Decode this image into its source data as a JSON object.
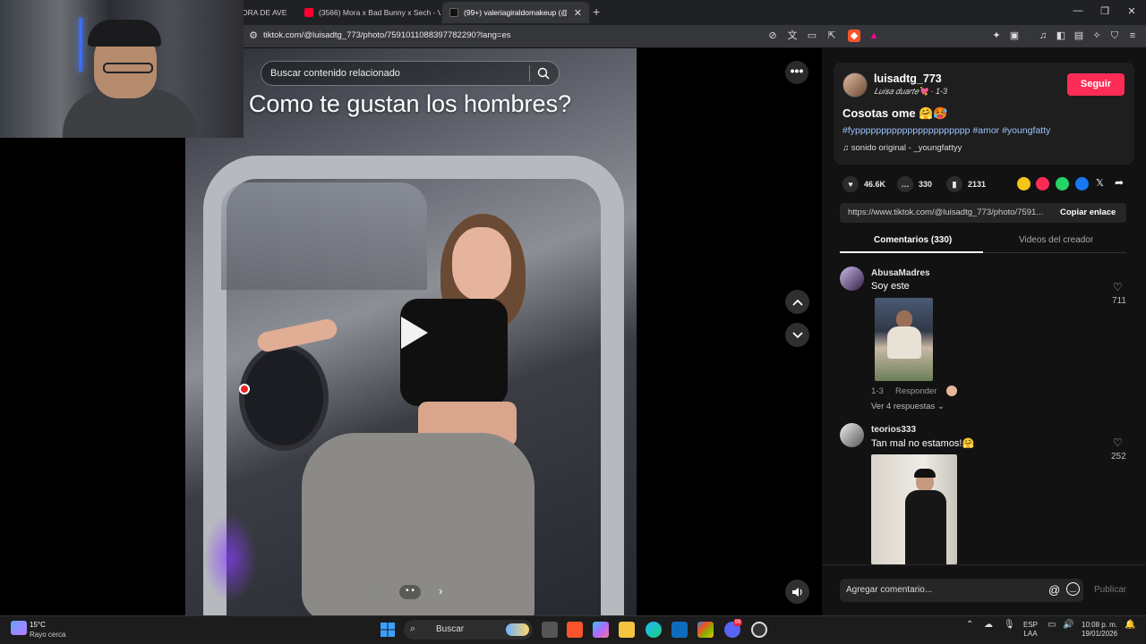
{
  "browser": {
    "tabs": [
      {
        "title": "ORA DE AVE",
        "favicon_color": "#444444"
      },
      {
        "title": "(3566) Mora x Bad Bunny x Sech - Vo",
        "favicon_color": "#ff0033"
      },
      {
        "title": "(99+) valeriagiraldomakeup (@va",
        "favicon_color": "#111111"
      }
    ],
    "new_tab_icon": "+",
    "url": "tiktok.com/@luisadtg_773/photo/7591011088397782290?lang=es"
  },
  "video": {
    "search_placeholder": "Buscar contenido relacionado",
    "caption": "Como te gustan los hombres?",
    "more_icon": "•••",
    "dots_label": "• •"
  },
  "post": {
    "username": "luisadtg_773",
    "nickname": "𝐿𝑢𝑖𝑠𝑎 𝑑𝑢𝑎𝑟𝑡𝑒💘 · 1-3",
    "follow_label": "Seguir",
    "description": "Cosotas ome 🤗🥵",
    "hashtags": "#fypppppppppppppppppppppp #amor #youngfatty",
    "sound": "♫  sonido original - _youngfattyy",
    "likes": "46.6K",
    "comments": "330",
    "saves": "2131",
    "share_colors": [
      "#f5c518",
      "#fe2c55",
      "#25d366",
      "#1877f2"
    ],
    "link": "https://www.tiktok.com/@luisadtg_773/photo/7591...",
    "copy_link_label": "Copiar enlace",
    "tab_comments": "Comentarios (330)",
    "tab_videos": "Videos del creador"
  },
  "comments": [
    {
      "user": "AbusaMadres",
      "text": "Soy este",
      "date": "1-3",
      "reply_label": "Responder",
      "view_replies": "Ver 4 respuestas",
      "likes": "711"
    },
    {
      "user": "teorios333",
      "text": "Tan mal no estamos!🤗",
      "likes": "252"
    }
  ],
  "comment_bar": {
    "placeholder": "Agregar comentario...",
    "at_icon": "@",
    "publish_label": "Publicar"
  },
  "taskbar": {
    "temperature": "15°C",
    "weather": "Rayo cerca",
    "search_label": "Buscar",
    "language_top": "ESP",
    "language_bottom": "LAA",
    "time": "10:08 p. m.",
    "date": "19/01/2026",
    "badge": "99"
  }
}
